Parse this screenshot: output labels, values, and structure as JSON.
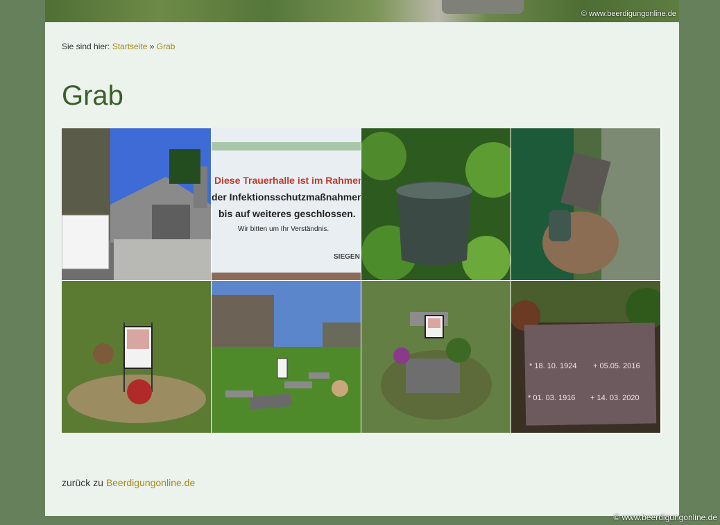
{
  "header": {
    "copyright": "© www.beerdigungonline.de"
  },
  "breadcrumb": {
    "prefix": "Sie sind hier:",
    "home": "Startseite",
    "separator": "»",
    "current": "Grab"
  },
  "page": {
    "title": "Grab"
  },
  "gallery": {
    "sign_text": {
      "line1": "Diese Trauerhalle ist im Rahmen",
      "line2": "der Infektionsschutzmaßnahmen",
      "line3": "bis auf weiteres geschlossen.",
      "line4": "Wir bitten um Ihr Verständnis.",
      "brand": "SIEGEN"
    },
    "plaque": {
      "date1": "* 18. 10. 1924",
      "date2": "+ 05.05. 2016",
      "date3": "* 01. 03. 1916",
      "date4": "+ 14. 03. 2020"
    }
  },
  "footer": {
    "back_prefix": "zurück zu",
    "back_link": "Beerdigungonline.de",
    "copyright": "© www.beerdigungonline.de"
  }
}
